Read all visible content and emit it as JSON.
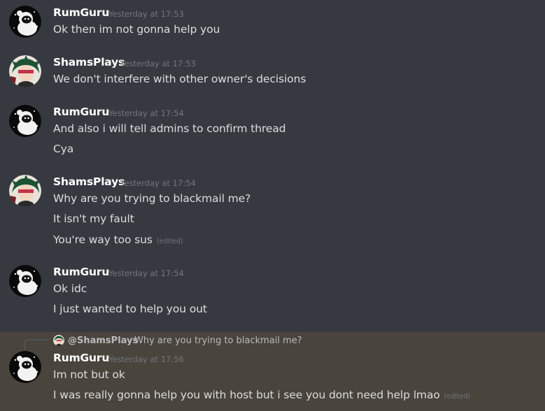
{
  "messages": [
    {
      "author": "RumGuru",
      "timestamp": "Yesterday at 17:53",
      "avatar_icon": "astronaut-avatar",
      "lines": [
        {
          "text": "Ok then im not gonna help you",
          "edited": ""
        }
      ]
    },
    {
      "author": "ShamsPlays",
      "timestamp": "Yesterday at 17:53",
      "avatar_icon": "anime-character-avatar",
      "lines": [
        {
          "text": "We don't interfere with other owner's decisions",
          "edited": ""
        }
      ]
    },
    {
      "author": "RumGuru",
      "timestamp": "Yesterday at 17:54",
      "avatar_icon": "astronaut-avatar",
      "lines": [
        {
          "text": "And also i will tell admins to confirm thread",
          "edited": ""
        },
        {
          "text": "Cya",
          "edited": ""
        }
      ]
    },
    {
      "author": "ShamsPlays",
      "timestamp": "Yesterday at 17:54",
      "avatar_icon": "anime-character-avatar",
      "lines": [
        {
          "text": "Why are you trying to blackmail me?",
          "edited": ""
        },
        {
          "text": "It isn't my fault",
          "edited": ""
        },
        {
          "text": "You're way too sus",
          "edited": "(edited)"
        }
      ]
    },
    {
      "author": "RumGuru",
      "timestamp": "Yesterday at 17:54",
      "avatar_icon": "astronaut-avatar",
      "lines": [
        {
          "text": "Ok idc",
          "edited": ""
        },
        {
          "text": "I just wanted to help you out",
          "edited": ""
        }
      ]
    },
    {
      "author": "RumGuru",
      "timestamp": "Yesterday at 17:56",
      "avatar_icon": "astronaut-avatar",
      "reply": {
        "mention": "@ShamsPlays",
        "text": "Why are you trying to blackmail me?"
      },
      "lines": [
        {
          "text": "Im not but ok",
          "edited": ""
        },
        {
          "text": "I was really gonna  help  you with host but i see you dont need help lmao",
          "edited": "(edited)"
        }
      ]
    }
  ],
  "colors": {
    "background": "#36393f",
    "highlight": "#49443c",
    "username": "#ffffff",
    "message_text": "#dcddde",
    "muted": "#72767d"
  }
}
